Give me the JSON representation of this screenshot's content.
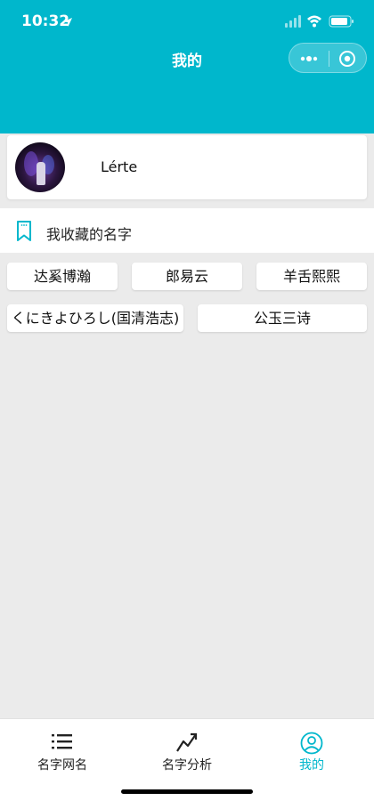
{
  "status_bar": {
    "time": "10:32"
  },
  "nav": {
    "title": "我的"
  },
  "profile": {
    "username": "Lérte"
  },
  "favorites": {
    "title": "我收藏的名字",
    "names": [
      "达奚博瀚",
      "郎易云",
      "羊舌熙熙",
      "くにきよひろし(国清浩志)",
      "公玉三诗"
    ]
  },
  "tabbar": {
    "tabs": [
      {
        "label": "名字网名",
        "icon": "list-icon"
      },
      {
        "label": "名字分析",
        "icon": "trend-icon"
      },
      {
        "label": "我的",
        "icon": "user-icon",
        "active": true
      }
    ]
  },
  "colors": {
    "accent": "#00b7cc",
    "background": "#ebebeb"
  }
}
